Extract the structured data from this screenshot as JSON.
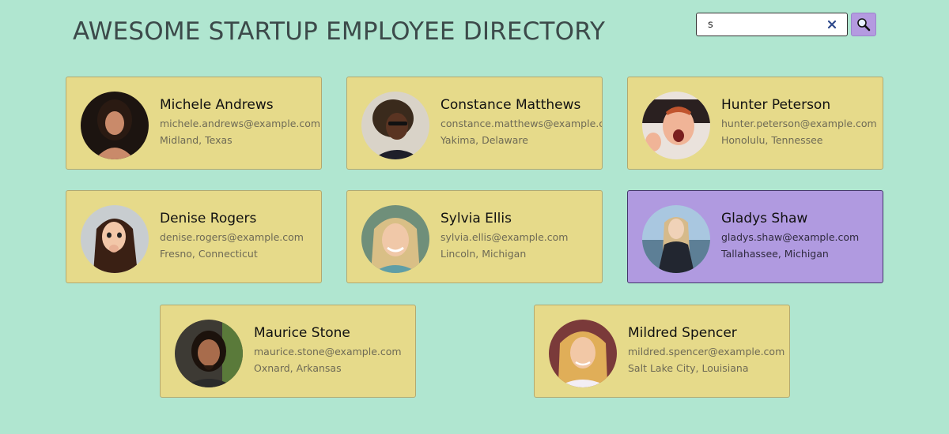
{
  "header": {
    "title": "AWESOME STARTUP EMPLOYEE DIRECTORY"
  },
  "search": {
    "value": "s",
    "clear_icon": "close-icon",
    "button_icon": "search-icon",
    "accent_color": "#b49ae0"
  },
  "colors": {
    "background": "#b0e6d0",
    "card": "#e6da8a",
    "card_selected": "#b09ae0"
  },
  "employees": [
    {
      "name": "Michele Andrews",
      "email": "michele.andrews@example.com",
      "location": "Midland, Texas",
      "selected": false
    },
    {
      "name": "Constance Matthews",
      "email": "constance.matthews@example.com",
      "location": "Yakima, Delaware",
      "selected": false
    },
    {
      "name": "Hunter Peterson",
      "email": "hunter.peterson@example.com",
      "location": "Honolulu, Tennessee",
      "selected": false
    },
    {
      "name": "Denise Rogers",
      "email": "denise.rogers@example.com",
      "location": "Fresno, Connecticut",
      "selected": false
    },
    {
      "name": "Sylvia Ellis",
      "email": "sylvia.ellis@example.com",
      "location": "Lincoln, Michigan",
      "selected": false
    },
    {
      "name": "Gladys Shaw",
      "email": "gladys.shaw@example.com",
      "location": "Tallahassee, Michigan",
      "selected": true
    },
    {
      "name": "Maurice Stone",
      "email": "maurice.stone@example.com",
      "location": "Oxnard, Arkansas",
      "selected": false
    },
    {
      "name": "Mildred Spencer",
      "email": "mildred.spencer@example.com",
      "location": "Salt Lake City, Louisiana",
      "selected": false
    }
  ]
}
